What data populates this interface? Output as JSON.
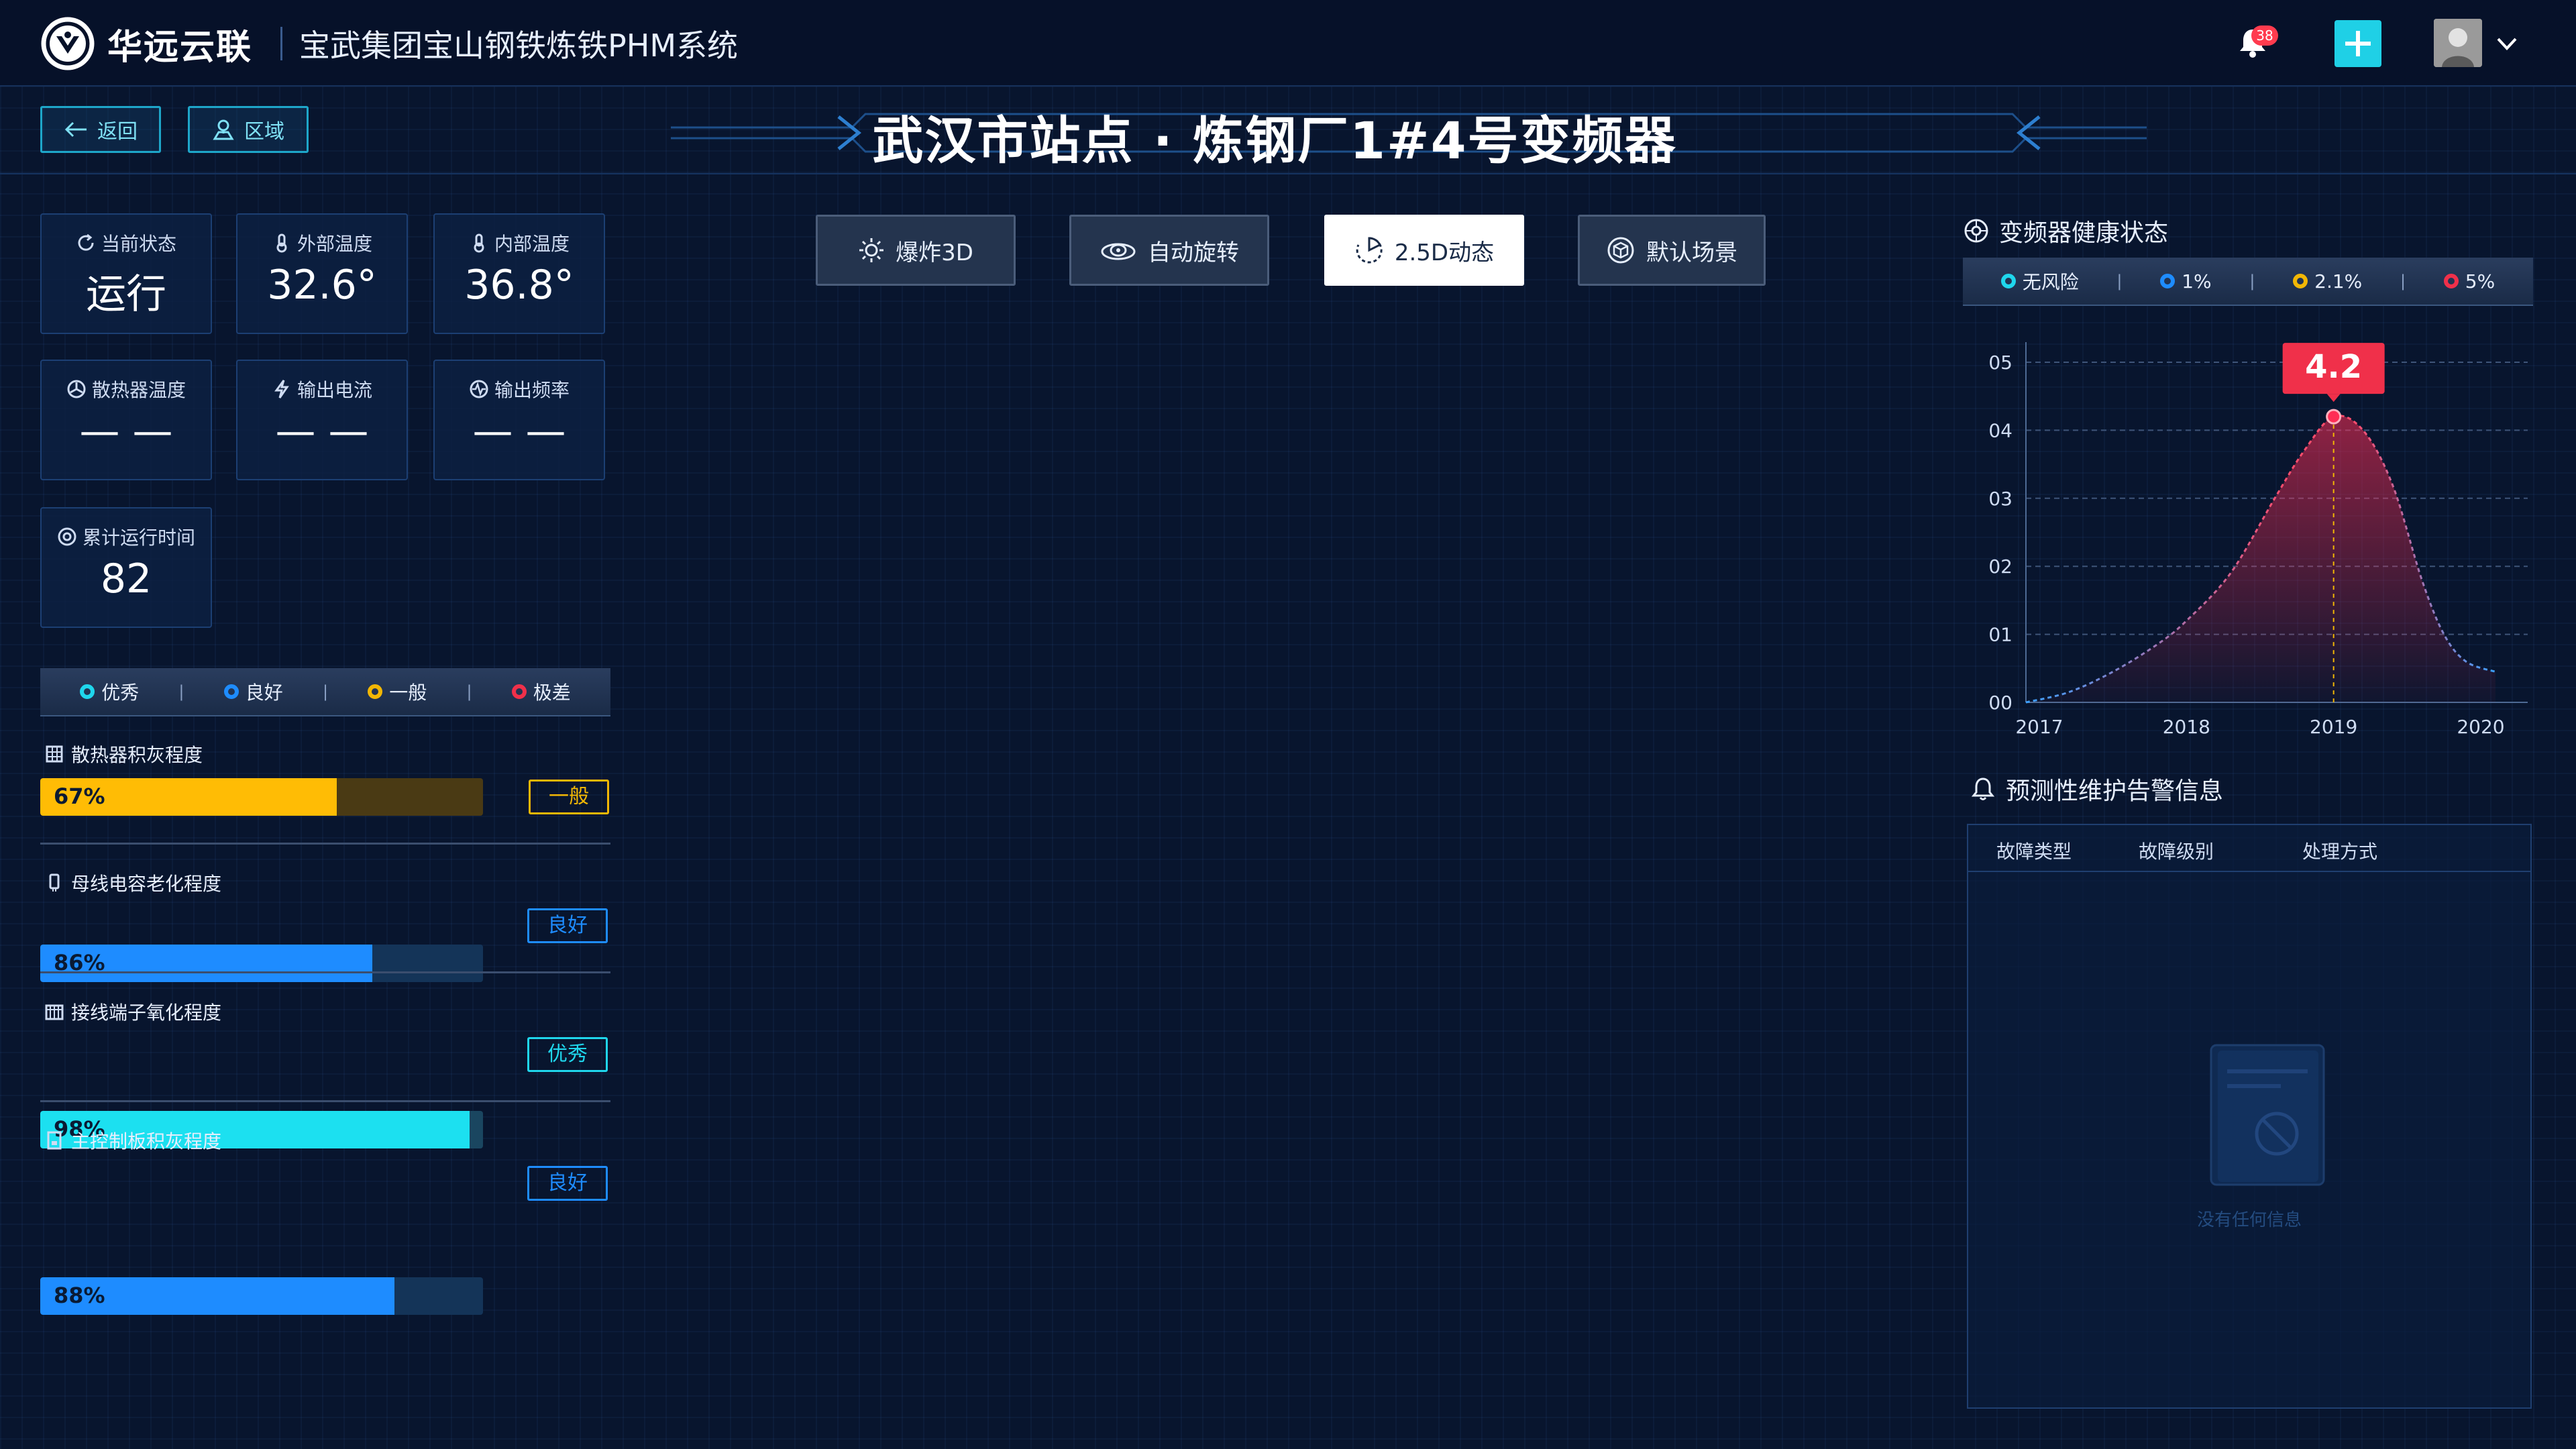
{
  "header": {
    "brand": "华远云联",
    "system_title": "宝武集团宝山钢铁炼铁PHM系统",
    "notification_count": "38",
    "icons": [
      "logo-icon",
      "bell-icon",
      "plus-icon",
      "avatar",
      "chevron-down-icon"
    ]
  },
  "nav": {
    "back_label": "返回",
    "area_label": "区域"
  },
  "page_title": "武汉市站点  ·  炼钢厂1#4号变频器",
  "metrics": [
    {
      "label": "当前状态",
      "value": "运行",
      "icon": "refresh-icon"
    },
    {
      "label": "外部温度",
      "value": "32.6°",
      "icon": "thermometer-icon"
    },
    {
      "label": "内部温度",
      "value": "36.8°",
      "icon": "thermometer-icon"
    },
    {
      "label": "散热器温度",
      "value": "— —",
      "icon": "fan-icon"
    },
    {
      "label": "输出电流",
      "value": "— —",
      "icon": "lightning-icon"
    },
    {
      "label": "输出频率",
      "value": "— —",
      "icon": "wave-icon"
    },
    {
      "label": "累计运行时间",
      "value": "82",
      "icon": "gear-icon"
    }
  ],
  "condition_legend": [
    {
      "label": "优秀",
      "color": "#1fd6ec"
    },
    {
      "label": "良好",
      "color": "#1e8cff"
    },
    {
      "label": "一般",
      "color": "#f2b705"
    },
    {
      "label": "极差",
      "color": "#f0304a"
    }
  ],
  "conditions": [
    {
      "label": "散热器积灰程度",
      "percent": 67,
      "percent_text": "67%",
      "status": "一般",
      "color": "#ffbc05",
      "track": "#4a3a14"
    },
    {
      "label": "母线电容老化程度",
      "percent": 86,
      "percent_text": "86%",
      "status": "良好",
      "color": "#1e8cff",
      "track": "#143458"
    },
    {
      "label": "接线端子氧化程度",
      "percent": 98,
      "percent_text": "98%",
      "status": "优秀",
      "color": "#1ce0f0",
      "track": "#1a4660"
    },
    {
      "label": "主控制板积灰程度",
      "percent": 88,
      "percent_text": "88%",
      "status": "良好",
      "color": "#1e8cff",
      "track": "#143458"
    }
  ],
  "view_buttons": [
    {
      "label": "爆炸3D",
      "icon": "explode-icon",
      "active": false
    },
    {
      "label": "自动旋转",
      "icon": "rotate-eye-icon",
      "active": false
    },
    {
      "label": "2.5D动态",
      "icon": "dynamic-icon",
      "active": true
    },
    {
      "label": "默认场景",
      "icon": "cube-icon",
      "active": false
    }
  ],
  "health": {
    "title": "变频器健康状态",
    "legend": [
      {
        "label": "无风险",
        "color": "#1fd6ec"
      },
      {
        "label": "1%",
        "color": "#1e8cff"
      },
      {
        "label": "2.1%",
        "color": "#f2b705"
      },
      {
        "label": "5%",
        "color": "#f0304a"
      }
    ]
  },
  "chart_data": {
    "type": "area",
    "x_ticks": [
      "2017",
      "2018",
      "2019",
      "2020"
    ],
    "y_ticks": [
      "00",
      "01",
      "02",
      "03",
      "04",
      "05"
    ],
    "ylim": [
      0,
      5
    ],
    "xlim": [
      2017,
      2020
    ],
    "series": [
      {
        "x": [
          2016.9,
          2017.2,
          2017.5,
          2017.8,
          2018.0,
          2018.3,
          2018.6,
          2018.8,
          2019.0,
          2019.2,
          2019.4,
          2019.6,
          2019.75,
          2019.9,
          2020.1
        ],
        "values": [
          0.0,
          0.15,
          0.45,
          0.85,
          1.2,
          1.9,
          3.0,
          3.7,
          4.2,
          4.0,
          3.2,
          1.8,
          1.0,
          0.6,
          0.45
        ]
      }
    ],
    "highlight": {
      "x": 2019,
      "value": 4.2,
      "label": "4.2"
    }
  },
  "alerts": {
    "title": "预测性维护告警信息",
    "columns": [
      "故障类型",
      "故障级别",
      "处理方式"
    ],
    "empty_text": "没有任何信息"
  }
}
